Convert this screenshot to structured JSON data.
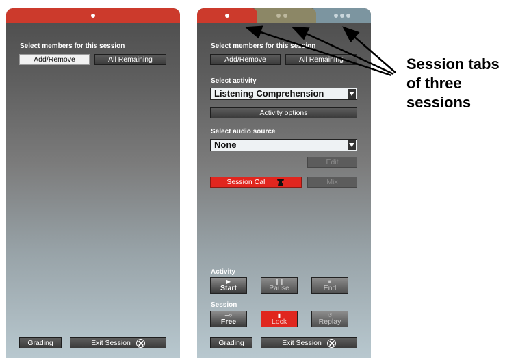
{
  "panel_single": {
    "members_heading": "Select members for this session",
    "add_remove": "Add/Remove",
    "all_remaining": "All Remaining",
    "grading": "Grading",
    "exit_session": "Exit Session"
  },
  "panel_multi": {
    "members_heading": "Select members for this session",
    "add_remove": "Add/Remove",
    "all_remaining": "All Remaining",
    "activity_heading": "Select activity",
    "activity_value": "Listening Comprehension",
    "activity_options": "Activity options",
    "audio_heading": "Select audio source",
    "audio_value": "None",
    "edit": "Edit",
    "session_call": "Session Call",
    "mix": "Mix",
    "activity_section": "Activity",
    "start": "Start",
    "pause": "Pause",
    "end": "End",
    "session_section": "Session",
    "free": "Free",
    "lock": "Lock",
    "replay": "Replay",
    "grading": "Grading",
    "exit_session": "Exit Session"
  },
  "tabs": [
    {
      "name": "session-1",
      "color": "#cc3a2c",
      "active": true
    },
    {
      "name": "session-2",
      "color": "#8c8766",
      "active": false
    },
    {
      "name": "session-3",
      "color": "#7c95a0",
      "active": false
    }
  ],
  "annotation": {
    "line1": "Session tabs",
    "line2": "of three",
    "line3": "sessions"
  }
}
